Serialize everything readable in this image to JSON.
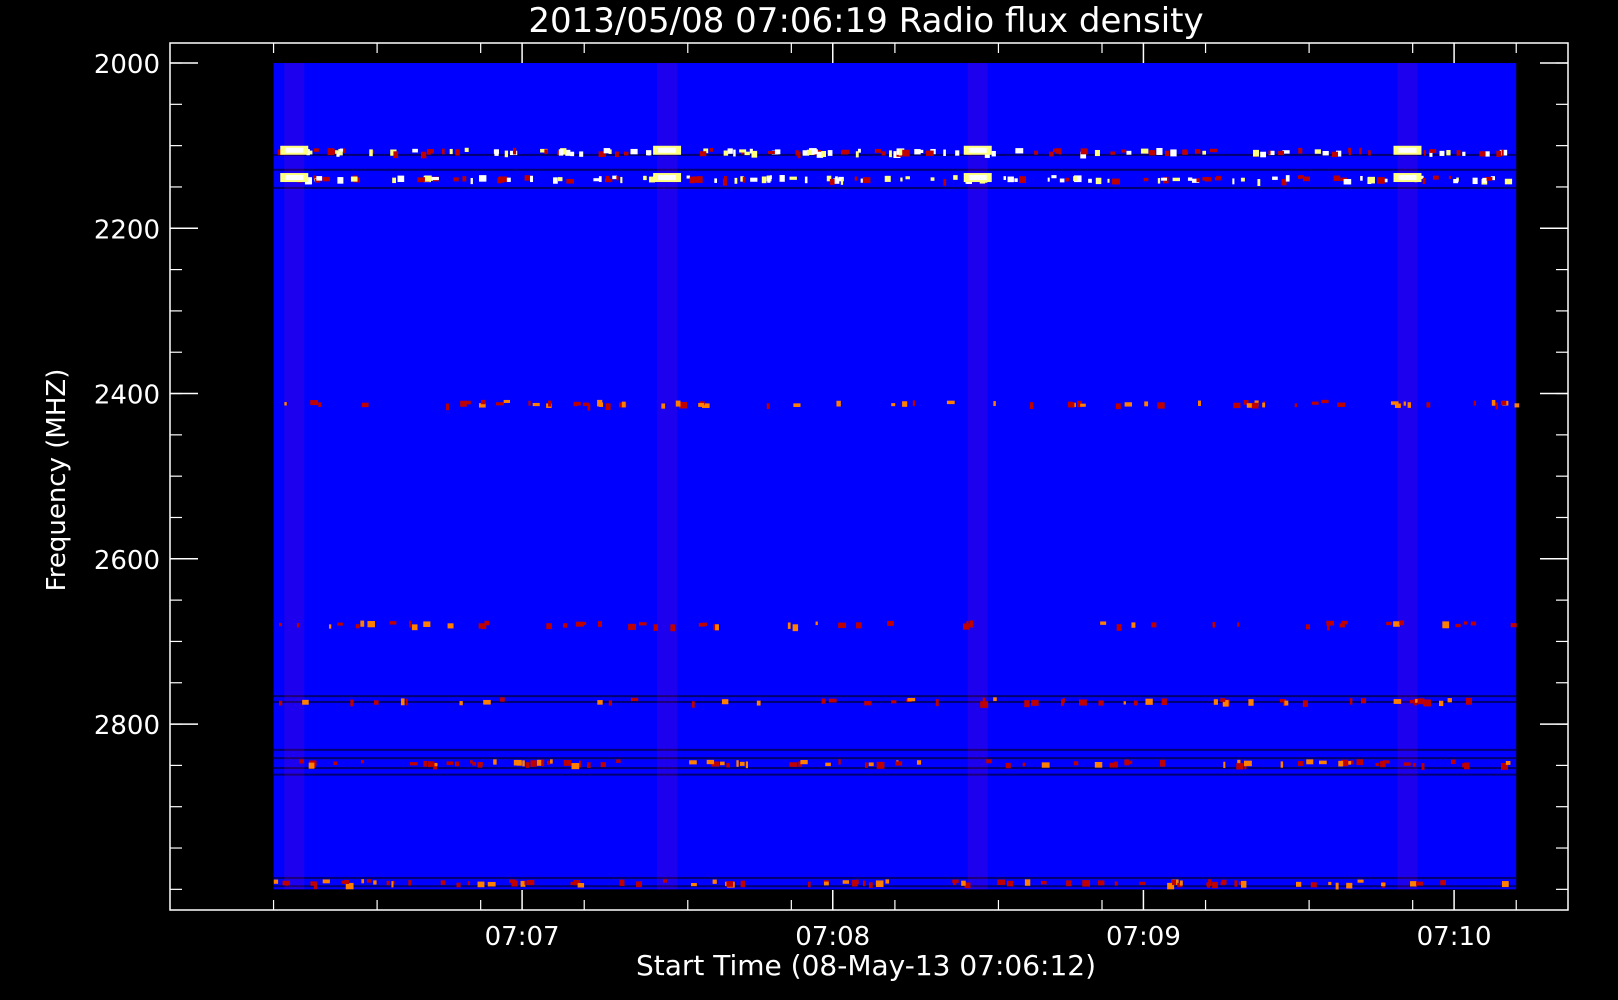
{
  "chart_data": {
    "type": "heatmap",
    "title": "2013/05/08 07:06:19 Radio flux density",
    "xlabel": "Start Time (08-May-13 07:06:12)",
    "ylabel": "Frequency (MHZ)",
    "x_start": "07:06:12",
    "x_end": "07:10:12",
    "x_range_seconds": [
      -20,
      250
    ],
    "x_ticks": [
      {
        "label": "07:07",
        "seconds": 48
      },
      {
        "label": "07:08",
        "seconds": 108
      },
      {
        "label": "07:09",
        "seconds": 168
      },
      {
        "label": "07:10",
        "seconds": 228
      }
    ],
    "ylim": [
      2000,
      3025
    ],
    "y_inverted": true,
    "y_ticks": [
      2000,
      2200,
      2400,
      2600,
      2800
    ],
    "data_extent": {
      "freq_min": 2000,
      "freq_max": 3000,
      "time_start_seconds": 0,
      "time_end_seconds": 240
    },
    "colormap": [
      "#000000",
      "#0000ff",
      "#c00000",
      "#ff8000",
      "#ffff80",
      "#ffffff"
    ],
    "background_color": "#0000ff",
    "hot_bands_mhz": [
      {
        "freq": 2105,
        "intensity": 0.95
      },
      {
        "freq": 2138,
        "intensity": 0.9
      },
      {
        "freq": 2410,
        "intensity": 0.45
      },
      {
        "freq": 2677,
        "intensity": 0.35
      },
      {
        "freq": 2770,
        "intensity": 0.35
      },
      {
        "freq": 2845,
        "intensity": 0.55
      },
      {
        "freq": 2990,
        "intensity": 0.55
      }
    ],
    "hot_columns_seconds": [
      4,
      76,
      136,
      219
    ]
  }
}
